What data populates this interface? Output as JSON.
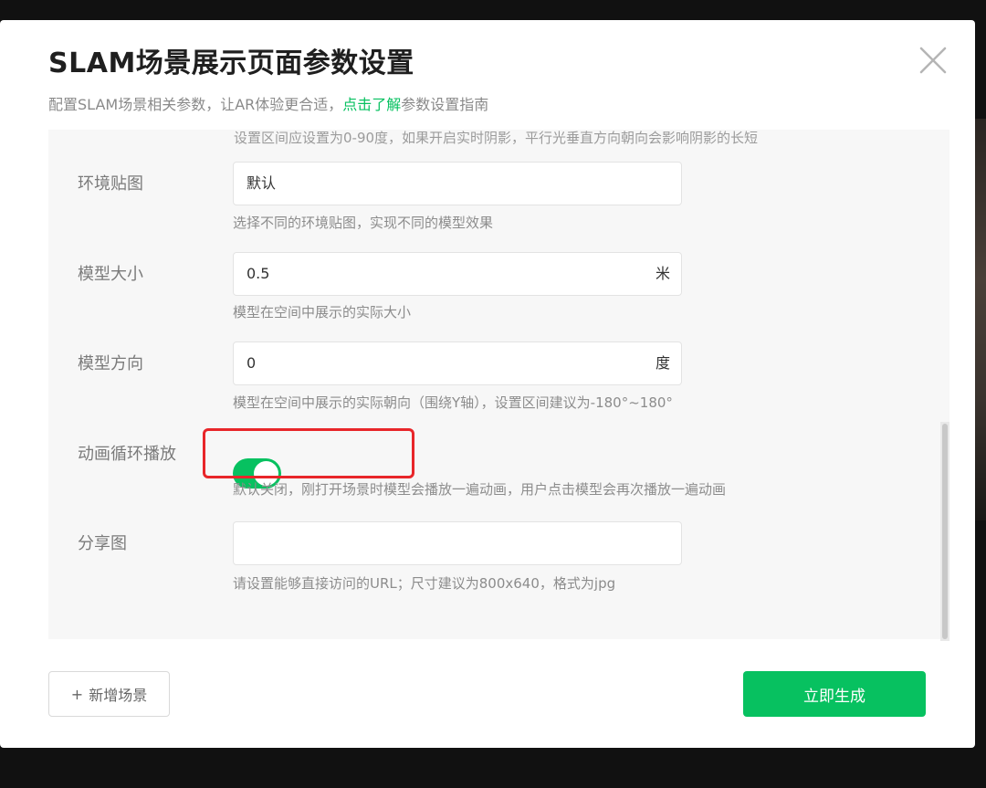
{
  "modal": {
    "title": "SLAM场景展示页面参数设置",
    "subtitle_prefix": "配置SLAM场景相关参数，让AR体验更合适，",
    "subtitle_link": "点击了解",
    "subtitle_suffix": "参数设置指南"
  },
  "form": {
    "cut_hint": "设置区间应设置为0-90度，如果开启实时阴影，平行光垂直方向朝向会影响阴影的长短",
    "fields": [
      {
        "label": "环境贴图",
        "value": "默认",
        "unit": "",
        "hint": "选择不同的环境贴图，实现不同的模型效果"
      },
      {
        "label": "模型大小",
        "value": "0.5",
        "unit": "米",
        "hint": "模型在空间中展示的实际大小"
      },
      {
        "label": "模型方向",
        "value": "0",
        "unit": "度",
        "hint": "模型在空间中展示的实际朝向（围绕Y轴），设置区间建议为-180°~180°"
      },
      {
        "label": "动画循环播放",
        "toggle_on": true,
        "hint": "默认关闭，刚打开场景时模型会播放一遍动画，用户点击模型会再次播放一遍动画"
      },
      {
        "label": "分享图",
        "value": "",
        "unit": "",
        "hint": "请设置能够直接访问的URL；尺寸建议为800x640，格式为jpg"
      }
    ]
  },
  "footer": {
    "add_scene_icon": "+",
    "add_scene_label": "新增场景",
    "generate_label": "立即生成"
  },
  "colors": {
    "accent": "#07c160",
    "highlight": "#e8262a"
  },
  "icons": {
    "close": "close-icon",
    "add": "plus-icon"
  }
}
